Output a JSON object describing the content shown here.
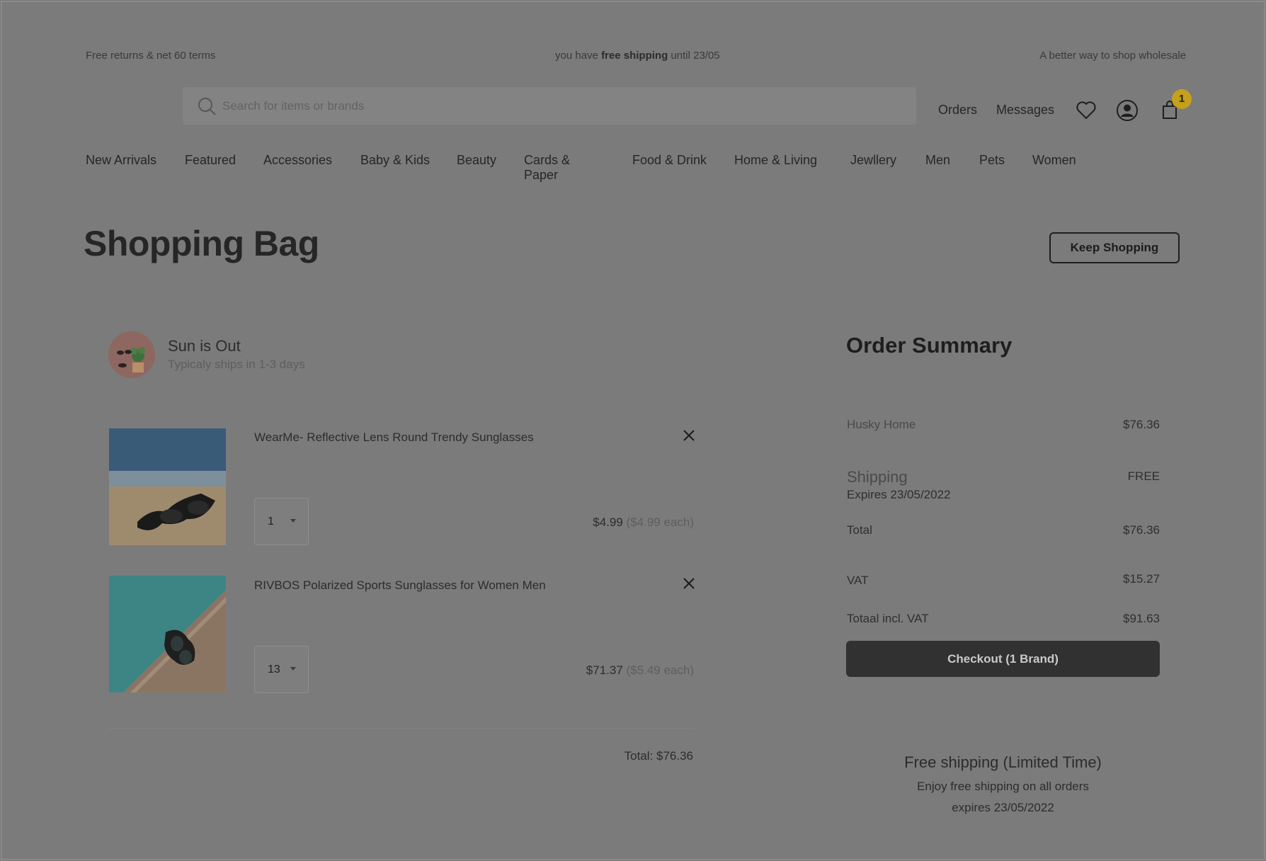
{
  "announcement": {
    "left": "Free returns & net 60 terms",
    "center_prefix": "you have",
    "center_bold": "free shipping",
    "center_suffix": "until 23/05",
    "right": "A better way to shop wholesale"
  },
  "header": {
    "search_placeholder": "Search for items or brands",
    "orders": "Orders",
    "messages": "Messages",
    "cart_count": "1",
    "icons": [
      "search-icon",
      "heart-icon",
      "user-icon",
      "shopping-bag-icon"
    ]
  },
  "nav": {
    "items": [
      "New Arrivals",
      "Featured",
      "Accessories",
      "Baby & Kids",
      "Beauty",
      "Cards &",
      "Paper",
      "Food & Drink",
      "Home & Living",
      "Jewllery",
      "Men",
      "Pets",
      "Women"
    ]
  },
  "page": {
    "title": "Shopping Bag",
    "keep_shopping": "Keep Shopping"
  },
  "brand": {
    "name": "Sun is Out",
    "shipping": "Typicaly ships in 1-3 days"
  },
  "items": [
    {
      "name": "WearMe- Reflective Lens Round Trendy Sunglasses",
      "qty": "1",
      "price": "$4.99",
      "each_open": "($4.99",
      "each_word": "each)"
    },
    {
      "name": "RIVBOS Polarized Sports Sunglasses for Women Men",
      "qty": "13",
      "price": "$71.37",
      "each_open": "($5.49",
      "each_word": "each)"
    }
  ],
  "cart_total": "Total: $76.36",
  "summary": {
    "title": "Order Summary",
    "brand_label": "Husky Home",
    "brand_value": "$76.36",
    "shipping_label": "Shipping",
    "shipping_value": "FREE",
    "shipping_expiry": "Expires 23/05/2022",
    "total_label": "Total",
    "total_value": "$76.36",
    "vat_label": "VAT",
    "vat_value": "$15.27",
    "incl_label": "Totaal incl. VAT",
    "incl_value": "$91.63",
    "checkout": "Checkout (1 Brand)"
  },
  "promo": {
    "title": "Free shipping (Limited Time)",
    "line1": "Enjoy free shipping on all orders",
    "line2": "expires 23/05/2022"
  },
  "colors": {
    "badge": "#c4a01c",
    "checkout": "#313131",
    "overlay_bg": "#7b7b7b"
  }
}
